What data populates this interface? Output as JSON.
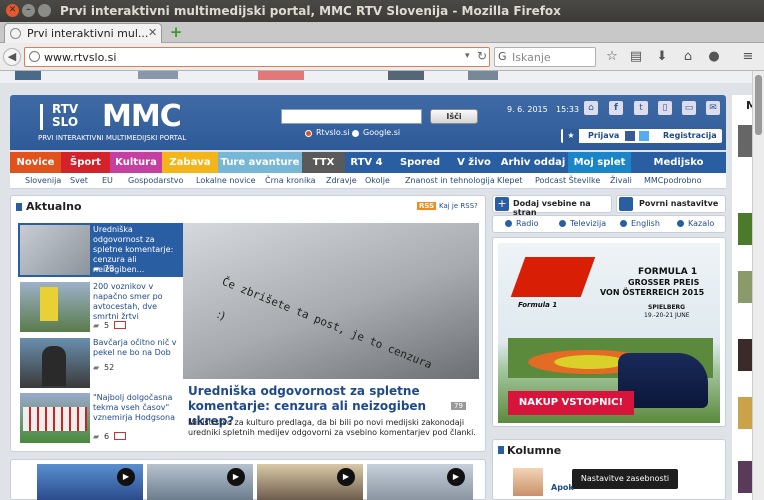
{
  "window": {
    "title": "Prvi interaktivni multimedijski portal, MMC RTV Slovenija - Mozilla Firefox"
  },
  "tab": {
    "label": "Prvi interaktivni mul..."
  },
  "nav": {
    "url": "www.rtvslo.si",
    "search_placeholder": "Iskanje"
  },
  "site": {
    "logo_top": "RTV",
    "logo_bottom": "SLO",
    "logo_mmc": "MMC",
    "logo_subtitle": "PRVI INTERAKTIVNI MULTIMEDIJSKI PORTAL",
    "search_button": "Išči",
    "radio_site": "Rtvslo.si",
    "radio_google": "Google.si",
    "date": "9. 6. 2015",
    "time": "15:33",
    "login": "Prijava",
    "register": "Registracija"
  },
  "menu": [
    {
      "label": "Novice",
      "color": "#e2521d"
    },
    {
      "label": "Šport",
      "color": "#d3222a"
    },
    {
      "label": "Kultura",
      "color": "#c43fa0"
    },
    {
      "label": "Zabava",
      "color": "#f3b51a"
    },
    {
      "label": "Ture avanture",
      "color": "#76b7d5"
    },
    {
      "label": "TTX",
      "color": "#5a5a5a"
    },
    {
      "label": "RTV 4",
      "color": "#2a5ea3"
    },
    {
      "label": "Spored",
      "color": "#2a5ea3"
    },
    {
      "label": "V živo",
      "color": "#2a5ea3"
    },
    {
      "label": "Arhiv oddaj",
      "color": "#2a5ea3"
    },
    {
      "label": "Moj splet",
      "color": "#1a86c9"
    },
    {
      "label": "Medijsko središče",
      "color": "#2a5ea3"
    }
  ],
  "submenu": [
    "Slovenija",
    "Svet",
    "EU",
    "Gospodarstvo",
    "Lokalne novice",
    "Črna kronika",
    "Zdravje",
    "Okolje",
    "Znanost in tehnologija",
    "Klepet",
    "Podcast Številke",
    "Živali",
    "MMCpodrobno"
  ],
  "aktualno": {
    "heading": "Aktualno",
    "rss": "RSS",
    "rss_link": "Kaj je RSS?",
    "items": [
      {
        "title": "Uredniška odgovornost za spletne komentarje: cenzura ali neizogiben...",
        "comments": "79"
      },
      {
        "title": "200 voznikov v napačno smer po avtocestah, dve smrtni žrtvi",
        "comments": "5"
      },
      {
        "title": "Bavčarja očitno nič v pekel ne bo na Dob",
        "comments": "52"
      },
      {
        "title": "\"Najbolj dolgočasna tekma vseh časov\" vznemirja Hodgsona",
        "comments": "6"
      }
    ],
    "main_title": "Uredniška odgovornost za spletne komentarje: cenzura ali neizogiben ukrep?",
    "main_comments": "79",
    "main_text": "Ministrstvo za kulturo predlaga, da bi bili po novi medijski zakonodaji uredniki spletnih medijev odgovorni za vsebino komentarjev pod članki.",
    "image_text_1": "Če zbrišete ta post, je to cenzura",
    "image_text_2": ":)"
  },
  "sidebar": {
    "add_content": "Dodaj vsebine na stran",
    "restore": "Povrni nastavitve",
    "links": [
      "Radio",
      "Televizija",
      "English",
      "Kazalo"
    ],
    "ad": {
      "line1": "FORMULA 1",
      "line2": "GROSSER PREIS",
      "line3": "VON ÖSTERREICH 2015",
      "place": "SPIELBERG",
      "dates": "19.-20-21 JUNE",
      "cta": "NAKUP VSTOPNIC!",
      "brand": "Formula 1"
    },
    "columns_heading": "Kolumne",
    "columns_author": "Apok"
  },
  "toast": "Nastavitve zasebnosti",
  "right_edge": "M"
}
